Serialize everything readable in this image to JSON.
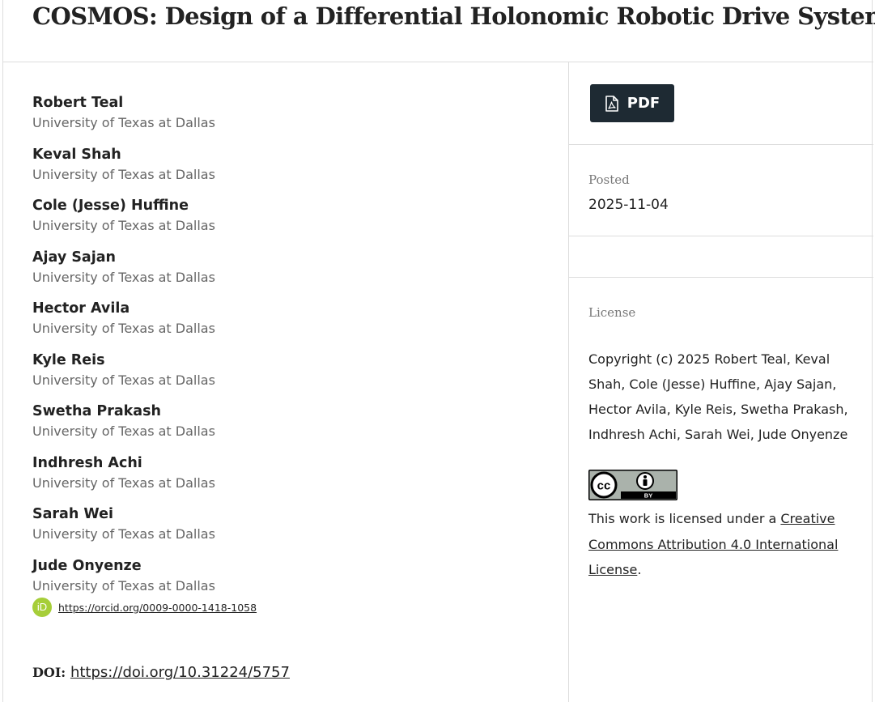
{
  "article": {
    "title": "COSMOS: Design of a Differential Holonomic Robotic Drive System"
  },
  "authors": [
    {
      "name": "Robert Teal",
      "affiliation": "University of Texas at Dallas"
    },
    {
      "name": "Keval Shah",
      "affiliation": "University of Texas at Dallas"
    },
    {
      "name": "Cole (Jesse) Huffine",
      "affiliation": "University of Texas at Dallas"
    },
    {
      "name": "Ajay Sajan",
      "affiliation": "University of Texas at Dallas"
    },
    {
      "name": "Hector Avila",
      "affiliation": "University of Texas at Dallas"
    },
    {
      "name": "Kyle Reis",
      "affiliation": "University of Texas at Dallas"
    },
    {
      "name": "Swetha Prakash",
      "affiliation": "University of Texas at Dallas"
    },
    {
      "name": "Indhresh Achi",
      "affiliation": "University of Texas at Dallas"
    },
    {
      "name": "Sarah Wei",
      "affiliation": "University of Texas at Dallas"
    },
    {
      "name": "Jude Onyenze",
      "affiliation": "University of Texas at Dallas"
    }
  ],
  "orcid": {
    "icon": "orcid-icon",
    "icon_text": "iD",
    "link": "https://orcid.org/0009-0000-1418-1058",
    "color": "#a6ce39"
  },
  "doi": {
    "label": "DOI:",
    "link": "https://doi.org/10.31224/5757"
  },
  "sidebar": {
    "pdf_label": "PDF",
    "pdf_icon": "file-pdf-icon",
    "posted_label": "Posted",
    "posted_date": "2025-11-04",
    "license_label": "License",
    "copyright": "Copyright (c) 2025 Robert Teal, Keval Shah, Cole (Jesse) Huffine, Ajay Sajan, Hector Avila, Kyle Reis, Swetha Prakash, Indhresh Achi, Sarah Wei, Jude Onyenze",
    "cc_badge_icon": "cc-by-badge-icon",
    "cc_badge_text": "BY",
    "license_prefix": "This work is licensed under a ",
    "license_link": "Creative Commons Attribution 4.0 International License",
    "license_suffix": "."
  },
  "colors": {
    "button_bg": "#1e2a33",
    "divider": "#dddddd",
    "muted_text": "#666666"
  }
}
